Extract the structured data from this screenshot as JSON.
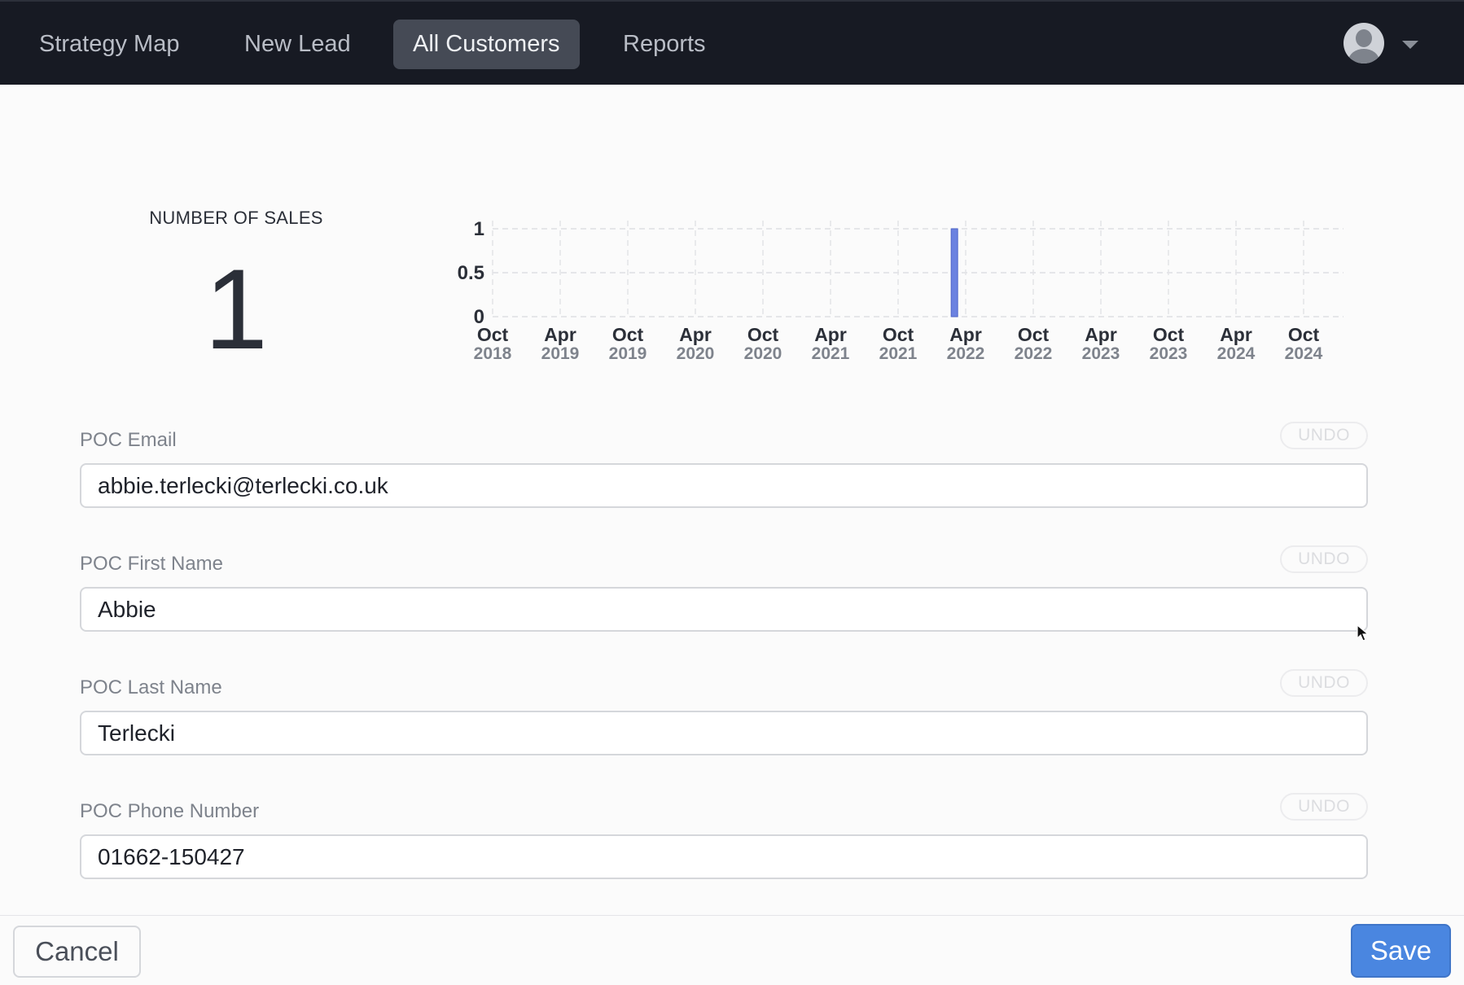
{
  "nav": {
    "items": [
      {
        "label": "Strategy Map",
        "active": false
      },
      {
        "label": "New Lead",
        "active": false
      },
      {
        "label": "All Customers",
        "active": true
      },
      {
        "label": "Reports",
        "active": false
      }
    ],
    "avatar_icon": "user-avatar-icon",
    "menu_icon": "caret-down-icon"
  },
  "stats": {
    "label": "NUMBER OF SALES",
    "value": "1"
  },
  "chart_data": {
    "type": "bar",
    "x": [
      {
        "month": "Oct",
        "year": "2018"
      },
      {
        "month": "Apr",
        "year": "2019"
      },
      {
        "month": "Oct",
        "year": "2019"
      },
      {
        "month": "Apr",
        "year": "2020"
      },
      {
        "month": "Oct",
        "year": "2020"
      },
      {
        "month": "Apr",
        "year": "2021"
      },
      {
        "month": "Oct",
        "year": "2021"
      },
      {
        "month": "Apr",
        "year": "2022"
      },
      {
        "month": "Oct",
        "year": "2022"
      },
      {
        "month": "Apr",
        "year": "2023"
      },
      {
        "month": "Oct",
        "year": "2023"
      },
      {
        "month": "Apr",
        "year": "2024"
      },
      {
        "month": "Oct",
        "year": "2024"
      }
    ],
    "bars": [
      {
        "date": "2022-03",
        "value": 1
      }
    ],
    "yticks": [
      "0",
      "0.5",
      "1"
    ],
    "ylim": [
      0,
      1
    ],
    "grid": true,
    "bar_color": "#6b82e0",
    "title": "",
    "xlabel": "",
    "ylabel": ""
  },
  "form": {
    "undo_label": "UNDO",
    "fields": [
      {
        "label": "POC Email",
        "value": "abbie.terlecki@terlecki.co.uk"
      },
      {
        "label": "POC First Name",
        "value": "Abbie"
      },
      {
        "label": "POC Last Name",
        "value": "Terlecki"
      },
      {
        "label": "POC Phone Number",
        "value": "01662-150427"
      }
    ]
  },
  "footer": {
    "cancel_label": "Cancel",
    "save_label": "Save"
  },
  "colors": {
    "nav_bg": "#171a23",
    "nav_active": "#454a55",
    "accent": "#4a86e0",
    "bar": "#6b82e0"
  }
}
